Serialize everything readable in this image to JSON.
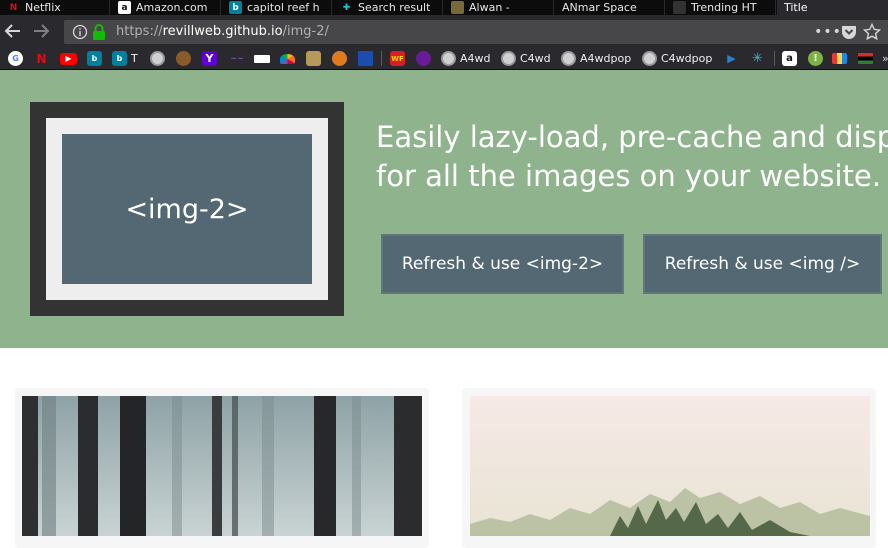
{
  "browser": {
    "tabs": [
      {
        "label": "Netflix",
        "active": false
      },
      {
        "label": "Amazon.com",
        "active": false
      },
      {
        "label": "capitol reef h",
        "active": false
      },
      {
        "label": "Search result",
        "active": false
      },
      {
        "label": "Alwan - ",
        "active": false
      },
      {
        "label": "ANmar Space",
        "active": false
      },
      {
        "label": "Trending HT",
        "active": false
      },
      {
        "label": "Title",
        "active": true
      }
    ],
    "url_prefix": "https://",
    "url_host": "revillweb.github.io",
    "url_path": "/img-2/",
    "bookmarks": {
      "text_items": [
        "T",
        "A4wd",
        "C4wd",
        "A4wdpop",
        "C4wdpop"
      ],
      "favicon_letters": {
        "google": "G",
        "netflix": "N",
        "bing1": "b",
        "bing2": "b",
        "yahoo": "Y",
        "wf": "WF"
      }
    }
  },
  "hero": {
    "preview_label": "<img-2>",
    "headline_line1": "Easily lazy-load, pre-cache and disp",
    "headline_line2": "for all the images on your website.",
    "button_img2": "Refresh & use <img-2>",
    "button_img": "Refresh & use <img />"
  },
  "colors": {
    "hero_bg": "#8fb38c",
    "slate": "#536872",
    "frame_dark": "#333333",
    "frame_light": "#eeeeee"
  }
}
